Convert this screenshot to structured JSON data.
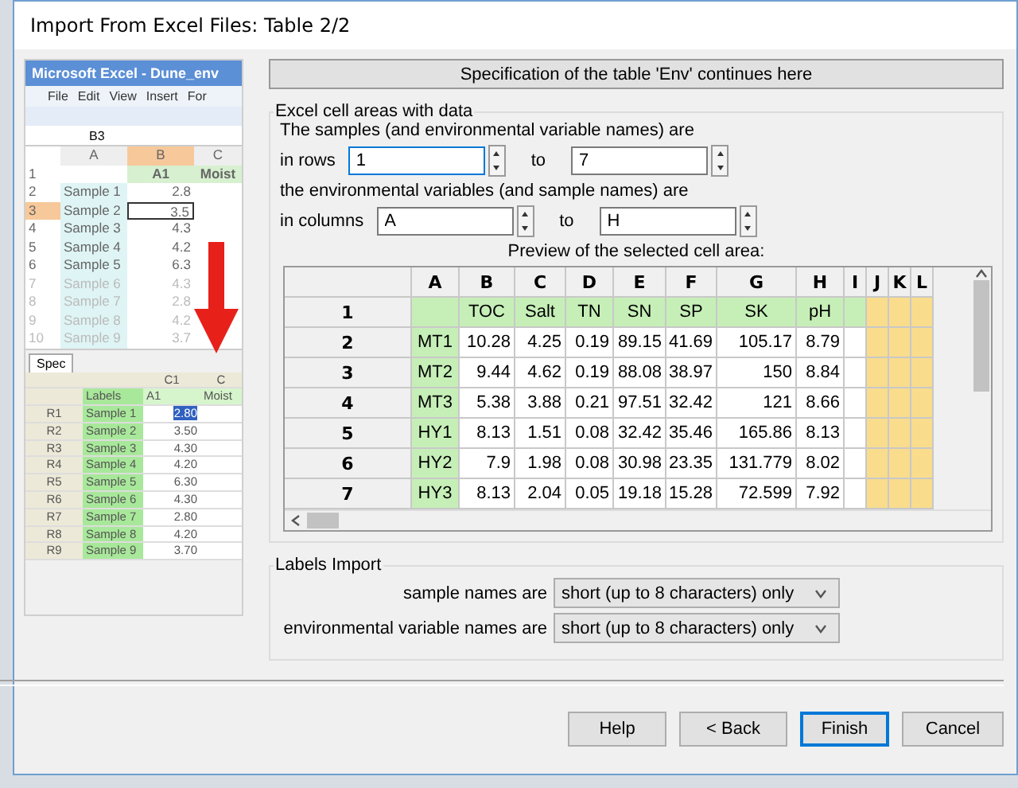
{
  "window": {
    "title": "Import From Excel Files: Table 2/2"
  },
  "excel_preview": {
    "title": "Microsoft Excel - Dune_env",
    "menu": [
      "File",
      "Edit",
      "View",
      "Insert",
      "For"
    ],
    "name_box": "B3",
    "columns": [
      "A",
      "B",
      "C"
    ],
    "header_row": {
      "number": "1",
      "cells": [
        "A1",
        "Moist"
      ]
    },
    "rows": [
      {
        "number": "2",
        "name": "Sample 1",
        "value": "2.8",
        "selected": false,
        "faded": false
      },
      {
        "number": "3",
        "name": "Sample 2",
        "value": "3.5",
        "selected": true,
        "faded": false
      },
      {
        "number": "4",
        "name": "Sample 3",
        "value": "4.3",
        "selected": false,
        "faded": false
      },
      {
        "number": "5",
        "name": "Sample 4",
        "value": "4.2",
        "selected": false,
        "faded": false
      },
      {
        "number": "6",
        "name": "Sample 5",
        "value": "6.3",
        "selected": false,
        "faded": false
      },
      {
        "number": "7",
        "name": "Sample 6",
        "value": "4.3",
        "selected": false,
        "faded": true
      },
      {
        "number": "8",
        "name": "Sample 7",
        "value": "2.8",
        "selected": false,
        "faded": true
      },
      {
        "number": "9",
        "name": "Sample 8",
        "value": "4.2",
        "selected": false,
        "faded": true
      },
      {
        "number": "10",
        "name": "Sample 9",
        "value": "3.7",
        "selected": false,
        "faded": true
      }
    ]
  },
  "spec_preview": {
    "tab": "Spec",
    "column_headers": [
      "C1",
      "C"
    ],
    "header_row": [
      "Labels",
      "A1",
      "Moist"
    ],
    "rows": [
      {
        "label": "R1",
        "name": "Sample 1",
        "value": "2.80",
        "selected": true
      },
      {
        "label": "R2",
        "name": "Sample 2",
        "value": "3.50",
        "selected": false
      },
      {
        "label": "R3",
        "name": "Sample 3",
        "value": "4.30",
        "selected": false
      },
      {
        "label": "R4",
        "name": "Sample 4",
        "value": "4.20",
        "selected": false
      },
      {
        "label": "R5",
        "name": "Sample 5",
        "value": "6.30",
        "selected": false
      },
      {
        "label": "R6",
        "name": "Sample 6",
        "value": "4.30",
        "selected": false
      },
      {
        "label": "R7",
        "name": "Sample 7",
        "value": "2.80",
        "selected": false
      },
      {
        "label": "R8",
        "name": "Sample 8",
        "value": "4.20",
        "selected": false
      },
      {
        "label": "R9",
        "name": "Sample 9",
        "value": "3.70",
        "selected": false
      }
    ]
  },
  "spec_button": "Specification of the table 'Env' continues here",
  "cell_areas": {
    "title": "Excel cell areas with data",
    "rows_caption": "The samples (and environmental variable names) are",
    "rows_label": "in rows",
    "rows_from": "1",
    "rows_to_label": "to",
    "rows_to": "7",
    "columns_caption": "the environmental variables (and sample names) are",
    "columns_label": "in columns",
    "columns_from": "A",
    "columns_to_label": "to",
    "columns_to": "H",
    "preview_title": "Preview of the selected cell area:"
  },
  "preview": {
    "columns": [
      "A",
      "B",
      "C",
      "D",
      "E",
      "F",
      "G",
      "H",
      "I",
      "J",
      "K",
      "L"
    ],
    "rows": [
      {
        "number": "1",
        "values": [
          "TOC",
          "Salt",
          "TN",
          "SN",
          "SP",
          "SK",
          "pH"
        ]
      },
      {
        "number": "2",
        "label": "MT1",
        "values": [
          "10.28",
          "4.25",
          "0.19",
          "89.15",
          "41.69",
          "105.17",
          "8.79"
        ]
      },
      {
        "number": "3",
        "label": "MT2",
        "values": [
          "9.44",
          "4.62",
          "0.19",
          "88.08",
          "38.97",
          "150",
          "8.84"
        ]
      },
      {
        "number": "4",
        "label": "MT3",
        "values": [
          "5.38",
          "3.88",
          "0.21",
          "97.51",
          "32.42",
          "121",
          "8.66"
        ]
      },
      {
        "number": "5",
        "label": "HY1",
        "values": [
          "8.13",
          "1.51",
          "0.08",
          "32.42",
          "35.46",
          "165.86",
          "8.13"
        ]
      },
      {
        "number": "6",
        "label": "HY2",
        "values": [
          "7.9",
          "1.98",
          "0.08",
          "30.98",
          "23.35",
          "131.779",
          "8.02"
        ]
      },
      {
        "number": "7",
        "label": "HY3",
        "values": [
          "8.13",
          "2.04",
          "0.05",
          "19.18",
          "15.28",
          "72.599",
          "7.92"
        ]
      }
    ]
  },
  "labels_import": {
    "title": "Labels Import",
    "fields": [
      {
        "label": "sample names are",
        "value": "short (up to 8 characters) only"
      },
      {
        "label": "environmental variable names are",
        "value": "short (up to 8 characters) only"
      }
    ]
  },
  "buttons": [
    {
      "label": "Help",
      "default": false
    },
    {
      "label": "< Back",
      "default": false
    },
    {
      "label": "Finish",
      "default": true
    },
    {
      "label": "Cancel",
      "default": false
    }
  ]
}
